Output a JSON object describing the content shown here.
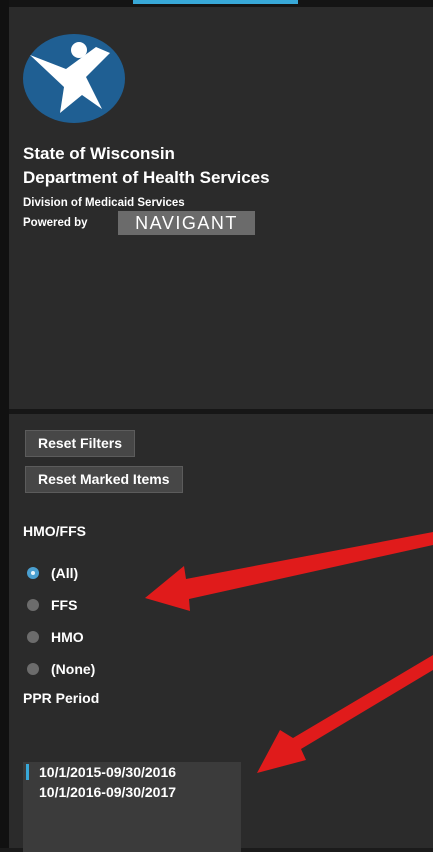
{
  "branding": {
    "state": "State of Wisconsin",
    "department": "Department of Health Services",
    "division": "Division of Medicaid Services",
    "powered_by": "Powered by",
    "vendor_logo_text": "NAVIGANT"
  },
  "filters": {
    "reset_filters_label": "Reset Filters",
    "reset_marked_label": "Reset Marked Items",
    "hmo_ffs": {
      "title": "HMO/FFS",
      "selected": "(All)",
      "options": [
        "(All)",
        "FFS",
        "HMO",
        "(None)"
      ]
    },
    "ppr_period": {
      "title": "PPR Period",
      "options": [
        "10/1/2015-09/30/2016",
        "10/1/2016-09/30/2017"
      ]
    }
  },
  "colors": {
    "panel_bg": "#2b2b2b",
    "accent": "#38a8d8",
    "radio_checked": "#4a9fd0",
    "annotation_arrow": "#e01b1b",
    "logo_circle": "#1f5f93"
  },
  "icons": {
    "logo": "wisconsin-dhs-person-icon",
    "annotations": "red-arrow-icon"
  }
}
